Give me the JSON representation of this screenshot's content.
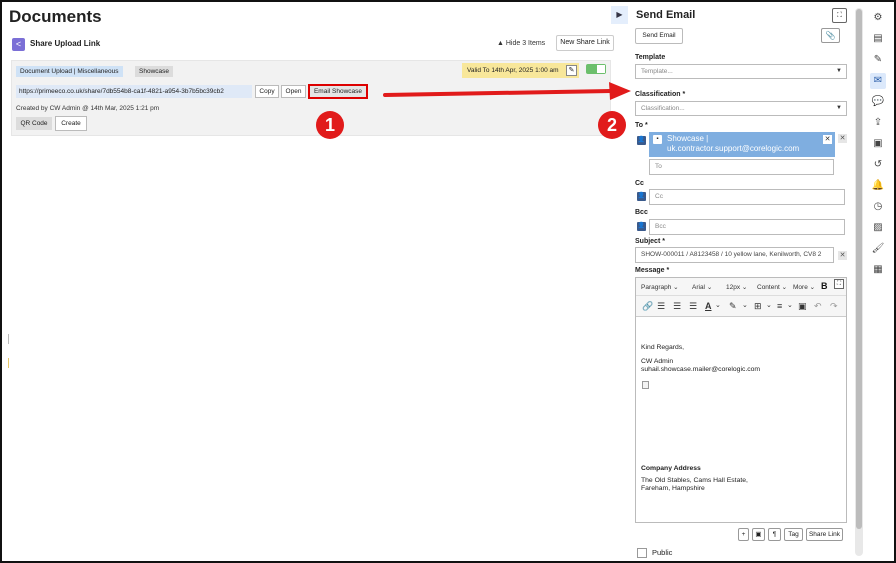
{
  "page": {
    "title": "Documents"
  },
  "share_link": {
    "section_title": "Share Upload Link",
    "hide_items": "Hide 3 Items",
    "new_share_link": "New Share Link",
    "tags": [
      "Document Upload | Miscellaneous",
      "Showcase"
    ],
    "valid_to": "Valid To 14th Apr, 2025 1:00 am",
    "url": "https://primeeco.co.uk/share/7db554b8-ca1f-4821-a954-3b7b5bc39cb2",
    "copy_label": "Copy",
    "open_label": "Open",
    "email_showcase_label": "Email Showcase",
    "created_by": "Created by CW Admin @ 14th Mar, 2025 1:21 pm",
    "qr_code_label": "QR Code",
    "create_label": "Create"
  },
  "callouts": [
    "1",
    "2"
  ],
  "send_email": {
    "title": "Send Email",
    "send_email_button": "Send Email",
    "template_label": "Template",
    "template_placeholder": "Template...",
    "classification_label": "Classification *",
    "classification_placeholder": "Classification...",
    "to_label": "To *",
    "to_chip_line1": "Showcase |",
    "to_chip_line2": "uk.contractor.support@corelogic.com",
    "to_placeholder": "To",
    "cc_label": "Cc",
    "cc_placeholder": "Cc",
    "bcc_label": "Bcc",
    "bcc_placeholder": "Bcc",
    "subject_label": "Subject *",
    "subject_value": "SHOW-000011 / A8123458 / 10 yellow lane, Kenilworth,  CV8 2",
    "message_label": "Message *",
    "toolbar": {
      "paragraph": "Paragraph",
      "font": "Arial",
      "size": "12px",
      "content": "Content",
      "more": "More",
      "bold": "B"
    },
    "message": {
      "regards": "Kind Regards,",
      "name": "CW Admin",
      "email": "suhail.showcase.mailer@corelogic.com",
      "company_heading": "Company Address",
      "address1": "The Old Stables, Cams Hall Estate,",
      "address2": "Fareham, Hampshire"
    },
    "tag_label": "Tag",
    "share_link_label": "Share Link",
    "public_label": "Public"
  },
  "icons": {
    "rail": [
      "gear-icon",
      "note-icon",
      "pencil-icon",
      "envelope-icon",
      "chat-icon",
      "upload-icon",
      "contact-icon",
      "history-icon",
      "bell-icon",
      "clock-icon",
      "image-icon",
      "brush-icon",
      "calculator-icon"
    ]
  },
  "colors": {
    "accent_blue": "#7faee0",
    "callout_red": "#e11b1b",
    "valid_yellow": "#f8e79a",
    "toggle_green": "#6cbf6c"
  }
}
